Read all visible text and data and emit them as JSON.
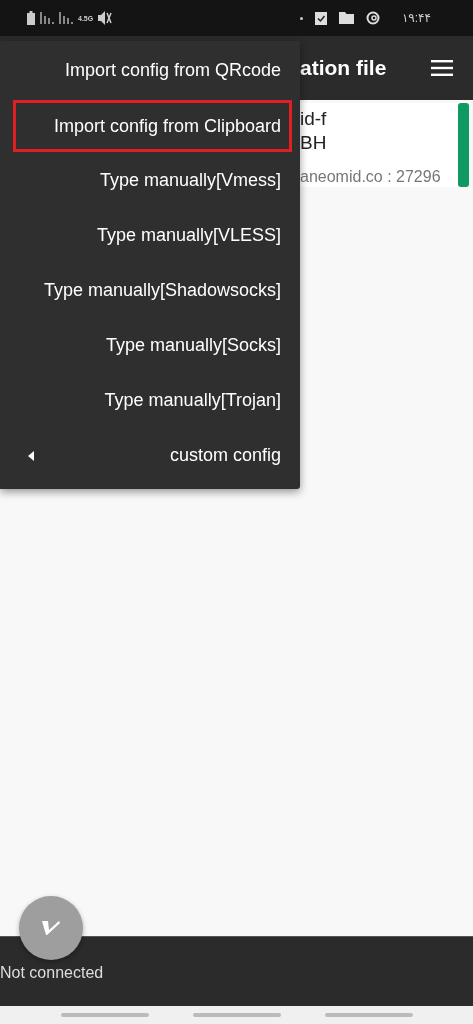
{
  "status_bar": {
    "network": "4.5G",
    "time": "۱۹:۴۴"
  },
  "app_bar": {
    "title": "ation file"
  },
  "server_card": {
    "line_1": "id-f",
    "line_2": "BH",
    "address": "aneomid.co : 27296",
    "selected": true
  },
  "menu": [
    {
      "label": "Import config from QRcode",
      "kind": "item",
      "selected": false
    },
    {
      "label": "Import config from Clipboard",
      "kind": "item",
      "selected": true
    },
    {
      "label": "Type manually[Vmess]",
      "kind": "item",
      "selected": false
    },
    {
      "label": "Type manually[VLESS]",
      "kind": "item",
      "selected": false
    },
    {
      "label": "Type manually[Shadowsocks]",
      "kind": "item",
      "selected": false
    },
    {
      "label": "Type manually[Socks]",
      "kind": "item",
      "selected": false
    },
    {
      "label": "Type manually[Trojan]",
      "kind": "item",
      "selected": false
    },
    {
      "label": "custom config",
      "kind": "submenu",
      "selected": false
    }
  ],
  "bottom_bar": {
    "status": "Not connected"
  }
}
